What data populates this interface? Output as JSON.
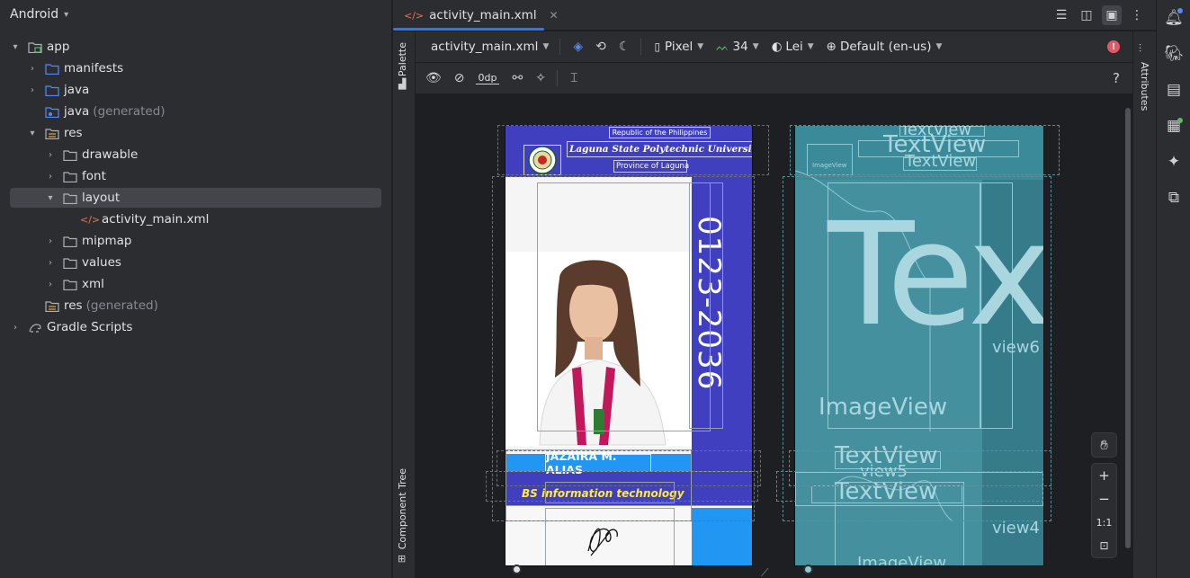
{
  "project": {
    "view_name": "Android",
    "tree": [
      {
        "label": "app",
        "extra": ""
      },
      {
        "label": "manifests",
        "extra": ""
      },
      {
        "label": "java",
        "extra": ""
      },
      {
        "label": "java",
        "extra": "(generated)"
      },
      {
        "label": "res",
        "extra": ""
      },
      {
        "label": "drawable",
        "extra": ""
      },
      {
        "label": "font",
        "extra": ""
      },
      {
        "label": "layout",
        "extra": ""
      },
      {
        "label": "activity_main.xml",
        "extra": ""
      },
      {
        "label": "mipmap",
        "extra": ""
      },
      {
        "label": "values",
        "extra": ""
      },
      {
        "label": "xml",
        "extra": ""
      },
      {
        "label": "res",
        "extra": "(generated)"
      },
      {
        "label": "Gradle Scripts",
        "extra": ""
      }
    ]
  },
  "editor": {
    "tab_label": "activity_main.xml",
    "palette_label": "Palette",
    "component_tree_label": "Component Tree",
    "attributes_label": "Attributes",
    "toolbar": {
      "file": "activity_main.xml",
      "device": "Pixel",
      "api": "34",
      "theme": "Lei",
      "locale": "Default (en-us)",
      "margin": "0dp",
      "help": "?"
    },
    "zoom": {
      "fit": "1:1"
    }
  },
  "design": {
    "republic": "Republic of the Philippines",
    "university": "Laguna State Polytechnic University",
    "province": "Province of Laguna",
    "id_number": "0123-2036",
    "name": "JAZAIRA M. ALIAS",
    "course": "BS information technology"
  },
  "blueprint": {
    "labels": {
      "tv1": "TextView",
      "tv2": "TextView",
      "tv3": "TextView",
      "img_small": "ImageView",
      "big_text": "Tex",
      "view6": "view6",
      "image_view": "ImageView",
      "tv4": "TextView",
      "view5": "view5",
      "tv5": "TextView",
      "view4": "view4",
      "image_view2": "ImageView"
    }
  },
  "colors": {
    "accent": "#3574f0",
    "card_blue": "#3f3fbf",
    "light_blue": "#2196f3",
    "course_yellow": "#ffeb3b",
    "blueprint": "#3b8a99"
  }
}
